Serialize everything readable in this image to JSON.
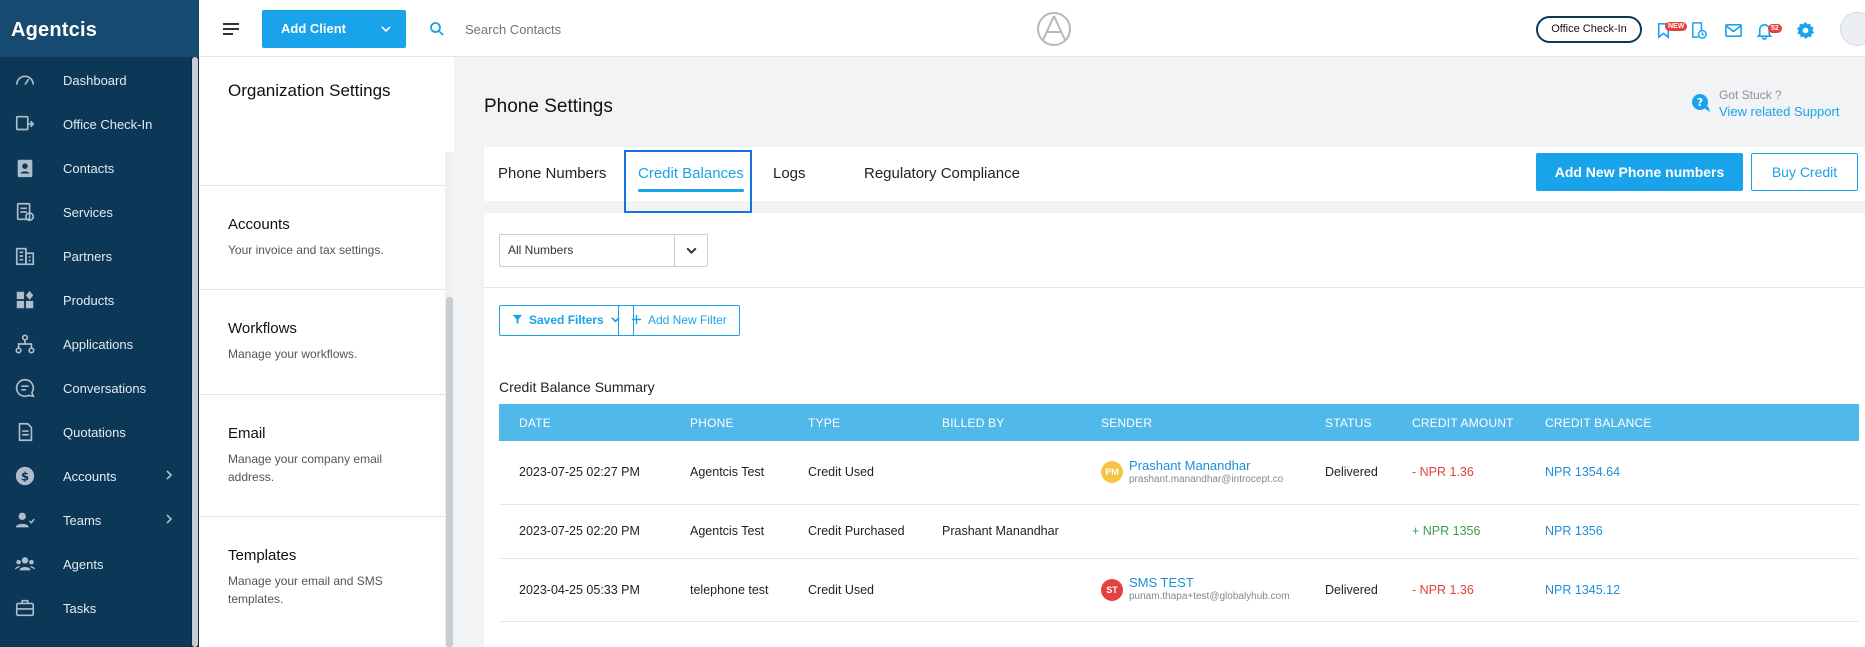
{
  "app": {
    "brand": "Agentcis"
  },
  "nav": {
    "items": [
      {
        "label": "Dashboard",
        "icon": "dashboard-icon",
        "has_submenu": false
      },
      {
        "label": "Office Check-In",
        "icon": "check-in-icon",
        "has_submenu": false
      },
      {
        "label": "Contacts",
        "icon": "contacts-icon",
        "has_submenu": false
      },
      {
        "label": "Services",
        "icon": "services-icon",
        "has_submenu": false
      },
      {
        "label": "Partners",
        "icon": "partners-icon",
        "has_submenu": false
      },
      {
        "label": "Products",
        "icon": "products-icon",
        "has_submenu": false
      },
      {
        "label": "Applications",
        "icon": "applications-icon",
        "has_submenu": false
      },
      {
        "label": "Conversations",
        "icon": "conversations-icon",
        "has_submenu": false
      },
      {
        "label": "Quotations",
        "icon": "quotations-icon",
        "has_submenu": false
      },
      {
        "label": "Accounts",
        "icon": "accounts-icon",
        "has_submenu": true
      },
      {
        "label": "Teams",
        "icon": "teams-icon",
        "has_submenu": true
      },
      {
        "label": "Agents",
        "icon": "agents-icon",
        "has_submenu": false
      },
      {
        "label": "Tasks",
        "icon": "tasks-icon",
        "has_submenu": false
      }
    ]
  },
  "topbar": {
    "add_client_label": "Add Client",
    "search_placeholder": "Search Contacts",
    "office_checkin_label": "Office Check-In",
    "new_badge": "NEW",
    "notification_count": "52"
  },
  "settings": {
    "title": "Organization Settings",
    "sections": [
      {
        "title": "Accounts",
        "description": "Your invoice and tax settings."
      },
      {
        "title": "Workflows",
        "description": "Manage your workflows."
      },
      {
        "title": "Email",
        "description": "Manage your company email address."
      },
      {
        "title": "Templates",
        "description": "Manage your email and SMS templates."
      }
    ]
  },
  "main": {
    "title": "Phone Settings",
    "help": {
      "question": "Got Stuck ?",
      "link": "View related Support"
    },
    "tabs": [
      {
        "label": "Phone Numbers",
        "active": false
      },
      {
        "label": "Credit Balances",
        "active": true
      },
      {
        "label": "Logs",
        "active": false
      },
      {
        "label": "Regulatory Compliance",
        "active": false
      }
    ],
    "add_phone_label": "Add New Phone numbers",
    "buy_credit_label": "Buy Credit",
    "number_filter": "All Numbers",
    "saved_filters_label": "Saved Filters",
    "add_filter_label": "Add New Filter",
    "summary_title": "Credit Balance Summary",
    "table": {
      "headers": [
        "DATE",
        "PHONE",
        "TYPE",
        "BILLED BY",
        "SENDER",
        "STATUS",
        "CREDIT AMOUNT",
        "CREDIT BALANCE"
      ],
      "rows": [
        {
          "date": "2023-07-25 02:27 PM",
          "phone": "Agentcis Test",
          "type": "Credit Used",
          "billed_by": "",
          "sender_initials": "PM",
          "sender_color": "#f6c342",
          "sender_name": "Prashant Manandhar",
          "sender_email": "prashant.manandhar@introcept.co",
          "status": "Delivered",
          "amount": "- NPR 1.36",
          "amount_kind": "neg",
          "balance": "NPR 1354.64"
        },
        {
          "date": "2023-07-25 02:20 PM",
          "phone": "Agentcis Test",
          "type": "Credit Purchased",
          "billed_by": "Prashant Manandhar",
          "sender_initials": "",
          "sender_color": "",
          "sender_name": "",
          "sender_email": "",
          "status": "",
          "amount": "+ NPR 1356",
          "amount_kind": "pos",
          "balance": "NPR 1356"
        },
        {
          "date": "2023-04-25 05:33 PM",
          "phone": "telephone test",
          "type": "Credit Used",
          "billed_by": "",
          "sender_initials": "ST",
          "sender_color": "#e5413c",
          "sender_name": "SMS TEST",
          "sender_email": "punam.thapa+test@globalyhub.com",
          "status": "Delivered",
          "amount": "- NPR 1.36",
          "amount_kind": "neg",
          "balance": "NPR 1345.12"
        }
      ]
    }
  },
  "colors": {
    "accent": "#19a3ea",
    "sidebar": "#0c3757",
    "table_header": "#51b9ea",
    "negative": "#e5413c",
    "positive": "#3aa14b"
  }
}
